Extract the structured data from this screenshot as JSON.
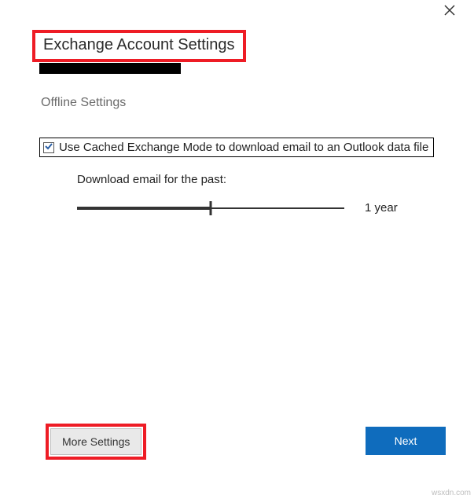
{
  "dialog": {
    "title": "Exchange Account Settings",
    "close_icon": "close"
  },
  "section": {
    "offline_heading": "Offline Settings"
  },
  "checkbox": {
    "cached_mode_checked": true,
    "cached_mode_label": "Use Cached Exchange Mode to download email to an Outlook data file"
  },
  "slider": {
    "label": "Download email for the past:",
    "value_label": "1 year",
    "position_percent": 50
  },
  "buttons": {
    "more_settings": "More Settings",
    "next": "Next"
  },
  "watermark": "wsxdn.com"
}
